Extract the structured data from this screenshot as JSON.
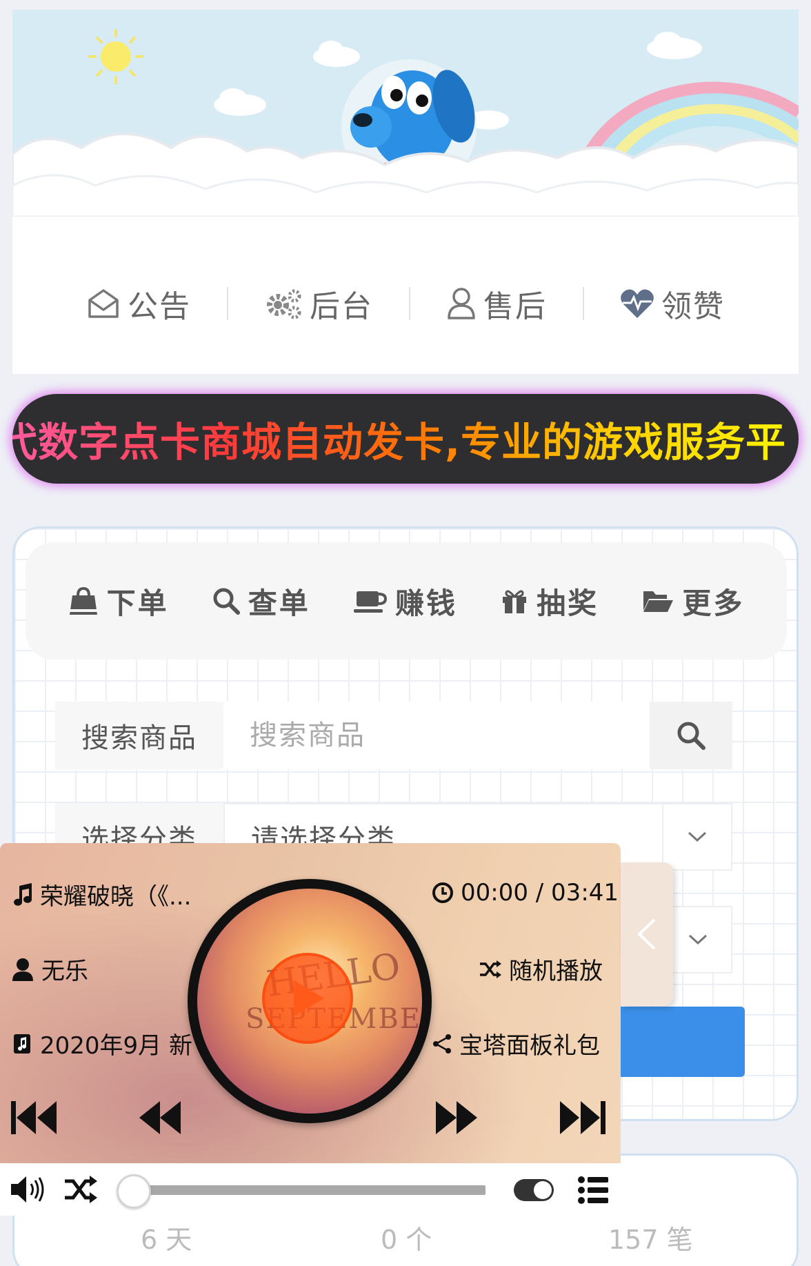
{
  "nav": {
    "items": [
      {
        "label": "公告",
        "icon": "envelope-open-icon"
      },
      {
        "label": "后台",
        "icon": "gears-icon"
      },
      {
        "label": "售后",
        "icon": "user-icon"
      },
      {
        "label": "领赞",
        "icon": "heartbeat-icon"
      }
    ]
  },
  "marquee": {
    "text": "代数字点卡商城自动发卡,专业的游戏服务平"
  },
  "tabs": [
    {
      "label": "下单",
      "icon": "shopping-bag-icon"
    },
    {
      "label": "查单",
      "icon": "search-icon"
    },
    {
      "label": "赚钱",
      "icon": "coffee-icon"
    },
    {
      "label": "抽奖",
      "icon": "gift-icon"
    },
    {
      "label": "更多",
      "icon": "folder-open-icon"
    }
  ],
  "search": {
    "label": "搜索商品",
    "placeholder": "搜索商品"
  },
  "category": {
    "label": "选择分类",
    "value": "请选择分类"
  },
  "player": {
    "song": "荣耀破晓（《...",
    "time": "00:00 / 03:41",
    "artist": "无乐",
    "mode": "随机播放",
    "album": "2020年9月 新",
    "share": "宝塔面板礼包",
    "cover_text_1": "HELLO",
    "cover_text_2": "SEPTEMBER",
    "progress_fraction": 0
  },
  "stats": {
    "days": "6 天",
    "count": "0 个",
    "orders": "157 笔"
  },
  "colors": {
    "accent": "#3b8fe8",
    "marquee_bg": "#2e2e30",
    "marquee_glow": "#e08cf0"
  }
}
